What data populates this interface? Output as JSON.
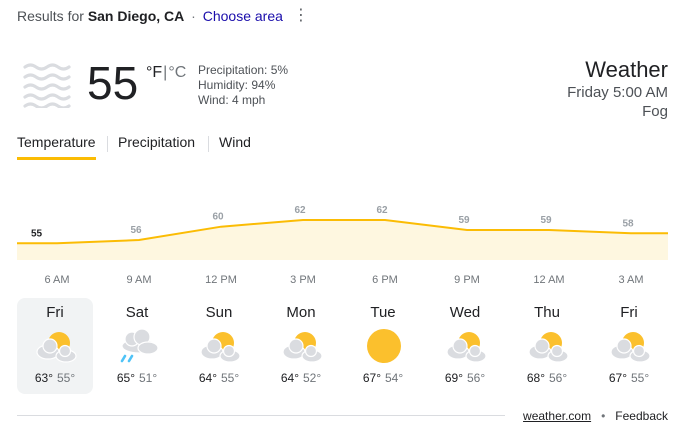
{
  "header": {
    "results_prefix": "Results for",
    "location": "San Diego, CA",
    "separator": "·",
    "choose_area": "Choose area",
    "more_icon": "⋮"
  },
  "current": {
    "condition_icon": "fog-icon",
    "temperature": "55",
    "unit_f": "°F",
    "unit_sep": "|",
    "unit_c": "°C",
    "precipitation": "Precipitation: 5%",
    "humidity": "Humidity: 94%",
    "wind": "Wind: 4 mph"
  },
  "summary": {
    "title": "Weather",
    "time": "Friday 5:00 AM",
    "condition": "Fog"
  },
  "tabs": [
    {
      "label": "Temperature",
      "active": true
    },
    {
      "label": "Precipitation",
      "active": false
    },
    {
      "label": "Wind",
      "active": false
    }
  ],
  "chart_data": {
    "type": "area",
    "metric": "Temperature",
    "x": [
      "6 AM",
      "9 AM",
      "12 PM",
      "3 PM",
      "6 PM",
      "9 PM",
      "12 AM",
      "3 AM"
    ],
    "values": [
      55,
      56,
      60,
      62,
      62,
      59,
      59,
      58
    ],
    "grid": false,
    "color": "#fbbc04",
    "fill": "#fef7e0"
  },
  "forecast": [
    {
      "day": "Fri",
      "icon": "partly-cloudy-icon",
      "high": "63°",
      "low": "55°",
      "selected": true
    },
    {
      "day": "Sat",
      "icon": "rain-cloud-icon",
      "high": "65°",
      "low": "51°",
      "selected": false
    },
    {
      "day": "Sun",
      "icon": "partly-cloudy-icon",
      "high": "64°",
      "low": "55°",
      "selected": false
    },
    {
      "day": "Mon",
      "icon": "partly-cloudy-icon",
      "high": "64°",
      "low": "52°",
      "selected": false
    },
    {
      "day": "Tue",
      "icon": "sun-icon",
      "high": "67°",
      "low": "54°",
      "selected": false
    },
    {
      "day": "Wed",
      "icon": "partly-cloudy-icon",
      "high": "69°",
      "low": "56°",
      "selected": false
    },
    {
      "day": "Thu",
      "icon": "partly-cloudy-icon",
      "high": "68°",
      "low": "56°",
      "selected": false
    },
    {
      "day": "Fri",
      "icon": "partly-cloudy-icon",
      "high": "67°",
      "low": "55°",
      "selected": false
    }
  ],
  "footer": {
    "source": "weather.com",
    "bullet": "•",
    "feedback": "Feedback"
  }
}
